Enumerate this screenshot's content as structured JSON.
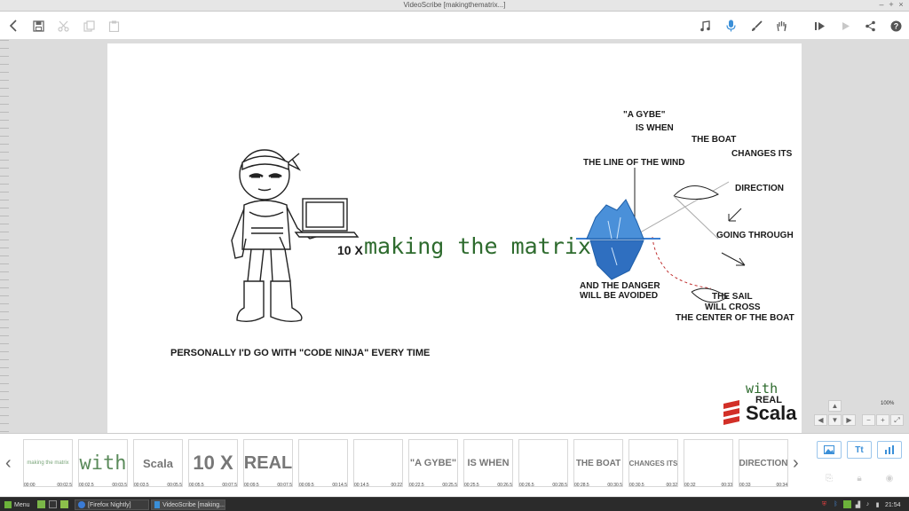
{
  "window": {
    "title": "VideoScribe [makingthematrix...]",
    "controls": [
      "–",
      "+",
      "×"
    ]
  },
  "toolbar": {
    "left_icons": [
      "back-icon",
      "save-icon",
      "cut-icon",
      "copy-icon",
      "paste-icon"
    ],
    "right_icons": [
      "music-icon",
      "microphone-icon",
      "brush-icon",
      "hand-icon",
      "play-from-icon",
      "play-icon",
      "share-icon",
      "help-icon"
    ],
    "accent": "#3a8fd8"
  },
  "canvas": {
    "headline_prefix": "10 X",
    "headline": "making the matrix",
    "headline_color": "#2e6b2e",
    "caption_ninja": "PERSONALLY I'D GO WITH \"CODE NINJA\" EVERY TIME",
    "gybe_1": "\"A GYBE\"",
    "gybe_2": "IS WHEN",
    "wind": "THE LINE OF THE WIND",
    "boat": "THE BOAT",
    "changes": "CHANGES ITS",
    "direction": "DIRECTION",
    "going": "GOING THROUGH",
    "danger_1": "AND THE DANGER",
    "danger_2": "WILL BE AVOIDED",
    "sail_1": "THE SAIL",
    "sail_2": "WILL CROSS",
    "sail_3": "THE CENTER OF THE BOAT",
    "logo_with": "with",
    "logo_real": "REAL",
    "logo_scala": "Scala",
    "scala_red": "#d22f27"
  },
  "zoom": {
    "label": "100%"
  },
  "timeline": {
    "thumbs": [
      {
        "label": "making the matrix",
        "t1": "00:00",
        "t2": "00:02.5"
      },
      {
        "label": "with",
        "t1": "00:02.5",
        "t2": "00:03.5"
      },
      {
        "label": "Scala",
        "t1": "00:03.5",
        "t2": "00:05.5"
      },
      {
        "label": "10 X",
        "t1": "00:05.5",
        "t2": "00:07.5"
      },
      {
        "label": "REAL",
        "t1": "00:09.5",
        "t2": "00:07.5"
      },
      {
        "label": "",
        "t1": "00:09.5",
        "t2": "00:14.5"
      },
      {
        "label": "",
        "t1": "00:14.5",
        "t2": "00:22"
      },
      {
        "label": "\"A GYBE\"",
        "t1": "00:22.5",
        "t2": "00:25.5"
      },
      {
        "label": "IS WHEN",
        "t1": "00:25.5",
        "t2": "00:26.5"
      },
      {
        "label": "",
        "t1": "00:26.5",
        "t2": "00:28.5"
      },
      {
        "label": "THE BOAT",
        "t1": "00:28.5",
        "t2": "00:30.5"
      },
      {
        "label": "CHANGES ITS",
        "t1": "00:30.5",
        "t2": "00:32"
      },
      {
        "label": "",
        "t1": "00:32",
        "t2": "00:33"
      },
      {
        "label": "DIRECTION",
        "t1": "00:33",
        "t2": "00:34"
      }
    ],
    "side_buttons": [
      "image-icon",
      "Tt",
      "chart-icon"
    ],
    "side_icons_disabled": [
      "paste-item-icon",
      "lock-icon",
      "eye-icon"
    ]
  },
  "taskbar": {
    "menu": "Menu",
    "windows": [
      "[Firefox Nightly]",
      "VideoScribe [making..."
    ],
    "time": "21:54"
  }
}
